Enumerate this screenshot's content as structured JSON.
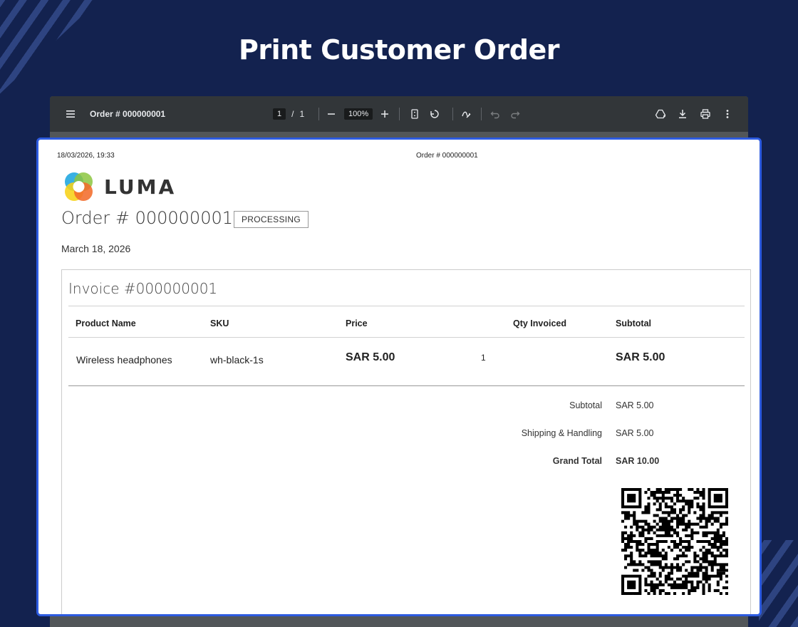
{
  "page": {
    "title": "Print Customer Order"
  },
  "viewer": {
    "document_title": "Order # 000000001",
    "page_current": "1",
    "page_separator": "/",
    "page_total": "1",
    "zoom": "100%",
    "icons": [
      "menu-icon",
      "zoom-out-icon",
      "zoom-in-icon",
      "fit-page-icon",
      "rotate-icon",
      "annotate-icon",
      "undo-icon",
      "redo-icon",
      "drive-icon",
      "download-icon",
      "print-icon",
      "more-icon"
    ]
  },
  "document": {
    "print_datetime": "18/03/2026, 19:33",
    "header_order": "Order # 000000001",
    "logo_text": "LUMA",
    "order_title": "Order # 000000001",
    "status": "PROCESSING",
    "order_date": "March 18, 2026",
    "invoice_title": "Invoice #000000001",
    "table": {
      "headers": [
        "Product Name",
        "SKU",
        "Price",
        "Qty Invoiced",
        "Subtotal"
      ],
      "rows": [
        {
          "name": "Wireless headphones",
          "sku": "wh-black-1s",
          "price": "SAR 5.00",
          "qty": "1",
          "subtotal": "SAR 5.00"
        }
      ]
    },
    "totals": [
      {
        "label": "Subtotal",
        "value": "SAR 5.00"
      },
      {
        "label": "Shipping & Handling",
        "value": "SAR 5.00"
      },
      {
        "label": "Grand Total",
        "value": "SAR 10.00"
      }
    ]
  },
  "colors": {
    "background": "#13224f",
    "accent_border": "#2d5be0",
    "toolbar": "#323639"
  }
}
